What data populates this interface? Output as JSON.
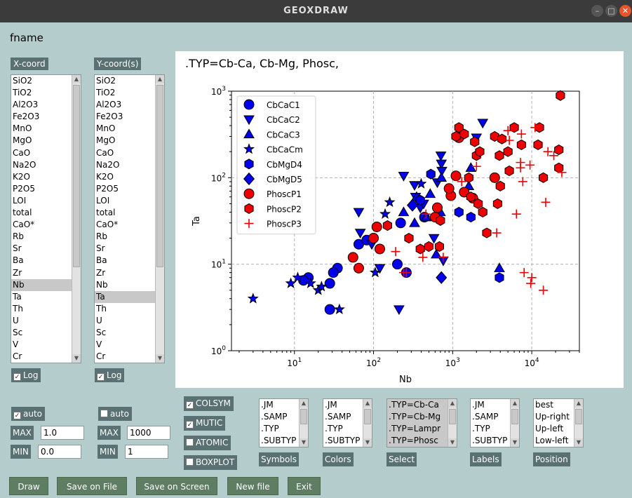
{
  "window": {
    "title": "GEOXDRAW"
  },
  "fname_label": "fname",
  "xcoord": {
    "header": "X-coord",
    "items": [
      "SiO2",
      "TiO2",
      "Al2O3",
      "Fe2O3",
      "MnO",
      "MgO",
      "CaO",
      "Na2O",
      "K2O",
      "P2O5",
      "LOI",
      "total",
      "CaO*",
      "Rb",
      "Sr",
      "Ba",
      "Zr",
      "Nb",
      "Ta",
      "Th",
      "U",
      "Sc",
      "V",
      "Cr"
    ],
    "selected": "Nb",
    "log_label": "Log"
  },
  "ycoord": {
    "header": "Y-coord(s)",
    "items": [
      "SiO2",
      "TiO2",
      "Al2O3",
      "Fe2O3",
      "MnO",
      "MgO",
      "CaO",
      "Na2O",
      "K2O",
      "P2O5",
      "LOI",
      "total",
      "CaO*",
      "Rb",
      "Sr",
      "Ba",
      "Zr",
      "Nb",
      "Ta",
      "Th",
      "U",
      "Sc",
      "V",
      "Cr"
    ],
    "selected": "Ta",
    "log_label": "Log"
  },
  "xrange": {
    "auto_label": "auto",
    "max_label": "MAX",
    "max_value": "1.0",
    "min_label": "MIN",
    "min_value": "0.0"
  },
  "yrange": {
    "auto_label": "auto",
    "max_label": "MAX",
    "max_value": "1000",
    "min_label": "MIN",
    "min_value": "1"
  },
  "options": {
    "colsym": "COLSYM",
    "mutic": "MUTIC",
    "atomic": "ATOMIC",
    "boxplot": "BOXPLOT"
  },
  "symbols": {
    "label": "Symbols",
    "items": [
      ".JM",
      ".SAMP",
      ".TYP",
      ".SUBTYP"
    ]
  },
  "colors": {
    "label": "Colors",
    "items": [
      ".JM",
      ".SAMP",
      ".TYP",
      ".SUBTYP"
    ]
  },
  "select": {
    "label": "Select",
    "items": [
      ".TYP=Cb-Ca",
      ".TYP=Cb-Mg",
      ".TYP=Lampr",
      ".TYP=Phosc"
    ]
  },
  "labels": {
    "label": "Labels",
    "items": [
      ".JM",
      ".SAMP",
      ".TYP",
      ".SUBTYP"
    ]
  },
  "position": {
    "label": "Position",
    "items": [
      "best",
      "Up-right",
      "Up-left",
      "Low-left"
    ]
  },
  "buttons": {
    "draw": "Draw",
    "save_file": "Save on File",
    "save_screen": "Save on Screen",
    "new_file": "New file",
    "exit": "Exit"
  },
  "chart_data": {
    "type": "scatter",
    "title": ".TYP=Cb-Ca, Cb-Mg, Phosc,",
    "xlabel": "Nb",
    "ylabel": "Ta",
    "xscale": "log",
    "yscale": "log",
    "xlim": [
      1.6,
      40000
    ],
    "ylim": [
      1,
      1000
    ],
    "xticks": [
      "10^1",
      "10^2",
      "10^3",
      "10^4"
    ],
    "yticks": [
      "10^0",
      "10^1",
      "10^2",
      "10^3"
    ],
    "grid": true,
    "legend_position": "top-left",
    "series": [
      {
        "name": "CbCaC1",
        "marker": "circle",
        "color": "#0000ee",
        "points": [
          [
            15,
            7
          ],
          [
            13,
            6.5
          ],
          [
            28,
            6
          ],
          [
            28,
            3
          ],
          [
            35,
            9
          ],
          [
            31,
            8
          ],
          [
            65,
            17
          ],
          [
            82,
            19
          ],
          [
            200,
            10
          ],
          [
            220,
            30
          ],
          [
            260,
            8
          ],
          [
            440,
            35
          ]
        ]
      },
      {
        "name": "CbCaC2",
        "marker": "triangle-down",
        "color": "#0000ee",
        "points": [
          [
            65,
            40
          ],
          [
            68,
            23
          ],
          [
            95,
            17
          ],
          [
            120,
            9
          ],
          [
            210,
            3
          ],
          [
            240,
            105
          ],
          [
            330,
            82
          ],
          [
            340,
            60
          ],
          [
            390,
            45
          ],
          [
            430,
            50
          ],
          [
            580,
            20
          ],
          [
            640,
            88
          ],
          [
            710,
            180
          ],
          [
            720,
            145
          ],
          [
            730,
            120
          ],
          [
            760,
            11
          ],
          [
            2400,
            430
          ],
          [
            2000,
            290
          ]
        ]
      },
      {
        "name": "CbCaC3",
        "marker": "triangle-up",
        "color": "#0000ee",
        "points": [
          [
            240,
            40
          ],
          [
            330,
            30
          ],
          [
            350,
            60
          ],
          [
            460,
            35
          ],
          [
            520,
            65
          ],
          [
            620,
            13
          ],
          [
            700,
            40
          ],
          [
            720,
            100
          ],
          [
            1700,
            130
          ],
          [
            1600,
            80
          ],
          [
            3900,
            9
          ]
        ]
      },
      {
        "name": "CbCaCm",
        "marker": "star",
        "color": "#0000ee",
        "points": [
          [
            3,
            4
          ],
          [
            9,
            6
          ],
          [
            11,
            7
          ],
          [
            16,
            6
          ],
          [
            20,
            5
          ],
          [
            22,
            5.5
          ],
          [
            37,
            3
          ],
          [
            105,
            8
          ],
          [
            140,
            38
          ],
          [
            160,
            52
          ],
          [
            400,
            85
          ]
        ]
      },
      {
        "name": "CbMgD4",
        "marker": "hexagon",
        "color": "#0000ee",
        "points": [
          [
            530,
            110
          ],
          [
            390,
            55
          ],
          [
            1200,
            40
          ],
          [
            1700,
            35
          ],
          [
            3900,
            7
          ]
        ]
      },
      {
        "name": "CbMgD5",
        "marker": "diamond",
        "color": "#0000ee",
        "points": [
          [
            720,
            7
          ],
          [
            310,
            48
          ]
        ]
      },
      {
        "name": "PhoscP1",
        "marker": "circle",
        "color": "#ee0000",
        "points": [
          [
            55,
            12
          ],
          [
            65,
            9
          ],
          [
            100,
            20
          ],
          [
            110,
            27
          ],
          [
            120,
            15
          ],
          [
            600,
            35
          ],
          [
            640,
            45
          ],
          [
            950,
            62
          ],
          [
            900,
            75
          ],
          [
            1100,
            105
          ],
          [
            1400,
            68
          ],
          [
            1800,
            58
          ],
          [
            3400,
            100
          ],
          [
            1200,
            290
          ]
        ]
      },
      {
        "name": "PhoscP2",
        "marker": "hexagon",
        "color": "#ee0000",
        "points": [
          [
            150,
            28
          ],
          [
            280,
            20
          ],
          [
            390,
            15
          ],
          [
            500,
            16
          ],
          [
            680,
            16
          ],
          [
            700,
            32
          ],
          [
            1100,
            300
          ],
          [
            1200,
            380
          ],
          [
            1400,
            320
          ],
          [
            1600,
            100
          ],
          [
            1700,
            60
          ],
          [
            1900,
            260
          ],
          [
            2000,
            180
          ],
          [
            2100,
            50
          ],
          [
            2200,
            200
          ],
          [
            2400,
            40
          ],
          [
            2700,
            23
          ],
          [
            3400,
            300
          ],
          [
            3700,
            50
          ],
          [
            3900,
            180
          ],
          [
            4000,
            80
          ],
          [
            4200,
            280
          ],
          [
            5000,
            200
          ],
          [
            5200,
            120
          ],
          [
            6000,
            380
          ],
          [
            7400,
            240
          ],
          [
            12000,
            240
          ],
          [
            12500,
            380
          ],
          [
            14000,
            100
          ],
          [
            22000,
            130
          ],
          [
            22000,
            210
          ],
          [
            23000,
            890
          ]
        ]
      },
      {
        "name": "PhoscP3",
        "marker": "plus",
        "color": "#ee0000",
        "points": [
          [
            190,
            14
          ],
          [
            240,
            8
          ],
          [
            260,
            8
          ],
          [
            420,
            12
          ],
          [
            460,
            38
          ],
          [
            760,
            12
          ],
          [
            1300,
            90
          ],
          [
            2000,
            135
          ],
          [
            3600,
            23
          ],
          [
            5000,
            350
          ],
          [
            5200,
            270
          ],
          [
            6400,
            38
          ],
          [
            7200,
            130
          ],
          [
            7200,
            150
          ],
          [
            7400,
            320
          ],
          [
            7700,
            90
          ],
          [
            8000,
            8
          ],
          [
            9500,
            140
          ],
          [
            9700,
            6
          ],
          [
            10000,
            7
          ],
          [
            11000,
            380
          ],
          [
            14000,
            5
          ],
          [
            15000,
            52
          ],
          [
            16000,
            200
          ],
          [
            19000,
            180
          ],
          [
            24000,
            115
          ]
        ]
      }
    ]
  }
}
